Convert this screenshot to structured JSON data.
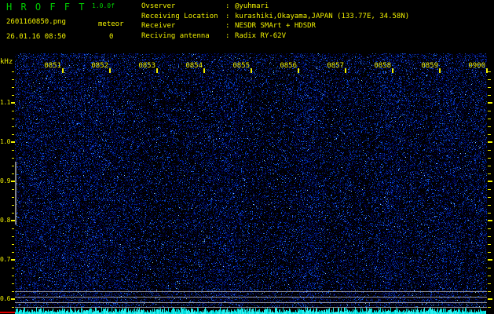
{
  "header": {
    "title": "H R O F F T",
    "version": "1.0.0f",
    "filename": "2601160850.png",
    "datetime": "26.01.16 08:50",
    "meteor_label": "meteor",
    "meteor_count": "0",
    "info": [
      {
        "label": "Ovserver",
        "colon": ":",
        "value": "@yuhmari"
      },
      {
        "label": "Receiving Location",
        "colon": ":",
        "value": "kurashiki,Okayama,JAPAN (133.77E, 34.58N)"
      },
      {
        "label": "Receiver",
        "colon": ":",
        "value": "NESDR SMArt + HDSDR"
      },
      {
        "label": "Reciving antenna",
        "colon": ":",
        "value": "Radix RY-62V"
      }
    ]
  },
  "chart_data": {
    "type": "heatmap",
    "subtype": "radio-spectrogram",
    "title": "HROFFT 10-minute spectrogram 0850-0900",
    "x_axis": {
      "labels": [
        "0851",
        "0852",
        "0853",
        "0854",
        "0855",
        "0856",
        "0857",
        "0858",
        "0859",
        "0900"
      ],
      "unit": "time HHMM"
    },
    "y_axis": {
      "unit_label": "kHz",
      "labels": [
        "1.1",
        "1.0",
        "0.9",
        "0.8",
        "0.7",
        "0.6"
      ],
      "range": [
        0.58,
        1.22
      ],
      "minor_step_khz": 0.02
    },
    "legend": "none",
    "grid": "off",
    "content": "uniform blue background noise only, no meteor echo streaks visible",
    "meteor_count_shown": 0,
    "bottom_strip": "cyan signal-level trace along bottom edge with red calibration mark at far left",
    "reference_lines_y_khz": [
      0.605,
      0.59,
      0.576,
      0.563
    ]
  },
  "colors": {
    "background": "#000000",
    "title_green": "#00cc00",
    "label_yellow": "#f0f000",
    "noise_blue": "#0000cc",
    "noise_bright": "#8cc8ff",
    "reference_gray": "#b8b8b8",
    "signal_cyan": "#00dcdc",
    "marker_red": "#e00000"
  }
}
